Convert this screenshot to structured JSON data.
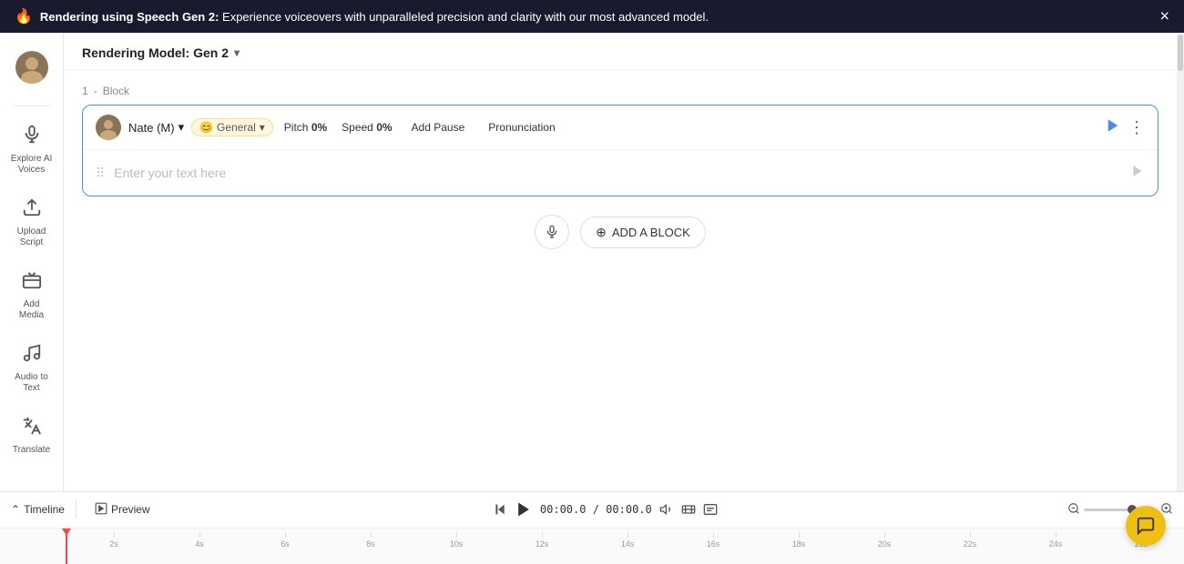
{
  "banner": {
    "icon": "🔥",
    "text_bold": "Rendering using Speech Gen 2:",
    "text_normal": " Experience voiceovers with unparalleled precision and clarity with our most advanced model.",
    "close_label": "×"
  },
  "sidebar": {
    "avatar_label": "User Avatar",
    "items": [
      {
        "id": "explore-ai-voices",
        "icon": "🎙",
        "label": "Explore AI\nVoices"
      },
      {
        "id": "upload-script",
        "icon": "📤",
        "label": "Upload\nScript"
      },
      {
        "id": "add-media",
        "icon": "🎬",
        "label": "Add Media"
      },
      {
        "id": "audio-to-text",
        "icon": "📝",
        "label": "Audio to\nText"
      },
      {
        "id": "translate",
        "icon": "🌐",
        "label": "Translate"
      }
    ]
  },
  "header": {
    "model_label": "Rendering Model: Gen 2",
    "chevron": "▾"
  },
  "block": {
    "number": "1",
    "label": "Block",
    "voice_name": "Nate (M)",
    "general_emoji": "😊",
    "general_label": "General",
    "pitch_label": "Pitch",
    "pitch_value": "0%",
    "speed_label": "Speed",
    "speed_value": "0%",
    "add_pause_label": "Add Pause",
    "pronunciation_label": "Pronunciation",
    "placeholder_text": "Enter your text here"
  },
  "add_block": {
    "mic_icon": "🎤",
    "button_label": "ADD A BLOCK"
  },
  "timeline": {
    "timeline_label": "Timeline",
    "timeline_icon": "⌄",
    "preview_label": "Preview",
    "skip_back_icon": "⏮",
    "play_icon": "▶",
    "time_current": "00:00.0",
    "time_total": "00:00.0",
    "volume_icon": "🔊",
    "film_icon": "🎬",
    "caption_icon": "⊟",
    "zoom_in_icon": "🔍",
    "zoom_out_icon": "🔍",
    "ruler_marks": [
      "2s",
      "4s",
      "6s",
      "8s",
      "10s",
      "12s",
      "14s",
      "16s",
      "18s",
      "20s",
      "22s",
      "24s",
      "26s"
    ]
  },
  "chat": {
    "icon": "💬"
  }
}
